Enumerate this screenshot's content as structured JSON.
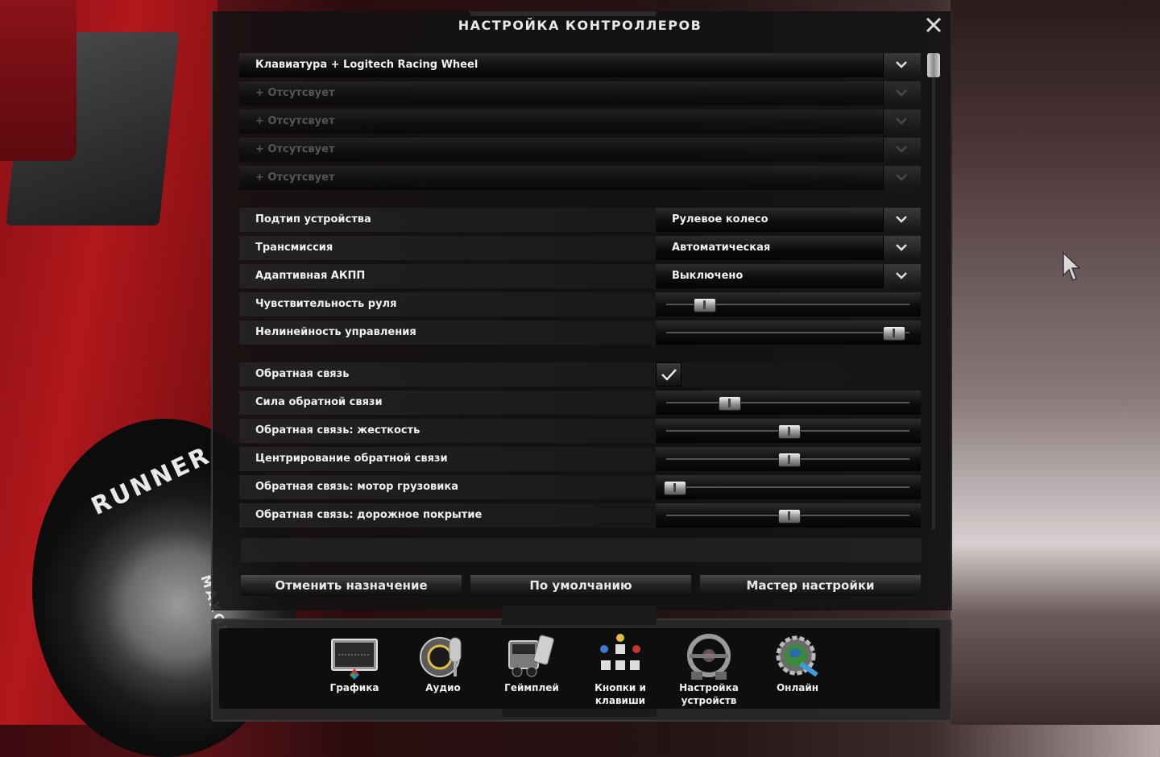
{
  "window": {
    "title": "НАСТРОЙКА КОНТРОЛЛЕРОВ"
  },
  "controllers": [
    {
      "label": "Клавиатура + Logitech Racing Wheel",
      "active": true
    },
    {
      "label": "+ Отсутсвует",
      "active": false
    },
    {
      "label": "+ Отсутсвует",
      "active": false
    },
    {
      "label": "+ Отсутсвует",
      "active": false
    },
    {
      "label": "+ Отсутсвует",
      "active": false
    }
  ],
  "settings": {
    "device_subtype": {
      "label": "Подтип устройства",
      "value": "Рулевое колесо"
    },
    "transmission": {
      "label": "Трансмиссия",
      "value": "Автоматическая"
    },
    "adaptive_akpp": {
      "label": "Адаптивная АКПП",
      "value": "Выключено"
    },
    "steering_sensitivity": {
      "label": "Чувствительность руля",
      "level": 0.15
    },
    "control_nonlinearity": {
      "label": "Нелинейность управления",
      "level": 0.98
    },
    "feedback": {
      "label": "Обратная связь",
      "checked": true
    },
    "feedback_strength": {
      "label": "Сила обратной связи",
      "level": 0.26
    },
    "feedback_stiffness": {
      "label": "Обратная связь: жесткость",
      "level": 0.52
    },
    "feedback_centering": {
      "label": "Центрирование обратной связи",
      "level": 0.52
    },
    "feedback_engine": {
      "label": "Обратная связь: мотор грузовика",
      "level": 0.02
    },
    "feedback_road": {
      "label": "Обратная связь: дорожное покрытие",
      "level": 0.52
    }
  },
  "buttons": {
    "unassign": "Отменить назначение",
    "defaults": "По умолчанию",
    "wizard": "Мастер настройки"
  },
  "menu": [
    {
      "label": "Графика",
      "icon": "graphics-monitor-icon"
    },
    {
      "label": "Аудио",
      "icon": "audio-microphone-icon"
    },
    {
      "label": "Геймплей",
      "icon": "gameplay-truck-icon"
    },
    {
      "label": "Кнопки и\nклавиши",
      "icon": "buttons-keys-icon"
    },
    {
      "label": "Настройка\nустройств",
      "icon": "steering-wheel-icon"
    },
    {
      "label": "Онлайн",
      "icon": "online-globe-icon"
    }
  ],
  "tire": {
    "brand": "RUNNER",
    "model": "MAXGRIP LDP"
  }
}
